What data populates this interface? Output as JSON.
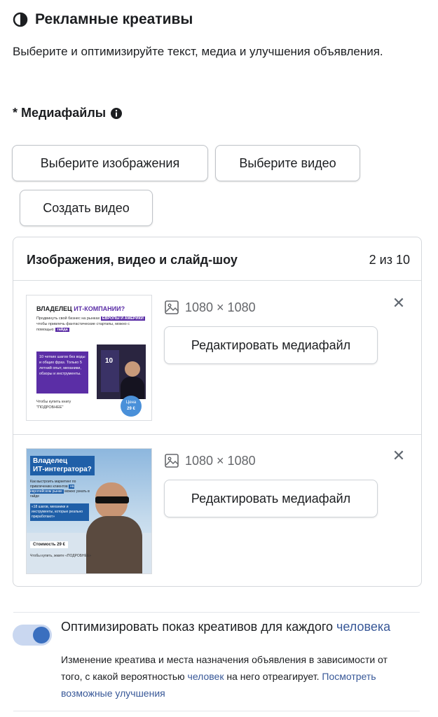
{
  "section": {
    "title": "Рекламные креативы",
    "description": "Выберите и оптимизируйте текст, медиа и улучшения объявления."
  },
  "media": {
    "label": "* Медиафайлы",
    "buttons": {
      "select_images": "Выберите изображения",
      "select_video": "Выберите видео",
      "create_video": "Создать видео"
    }
  },
  "library": {
    "title": "Изображения, видео и слайд-шоу",
    "count": "2 из 10",
    "items": [
      {
        "dimensions": "1080 × 1080",
        "edit_label": "Редактировать медиафайл",
        "thumb": {
          "heading_a": "ВЛАДЕЛЕЦ ",
          "heading_b": "ИТ-КОМПАНИИ?",
          "line1": "Продвинуть свой бизнес на рынках",
          "tag1": "ЕВРОПЫ И АМЕРИКИ",
          "line2": "чтобы привлечь",
          "line3": "фантастические стартапы, можно с помощью:",
          "tag2": "гайда",
          "box": "10 четких шагов без воды и общих фраз. Только 5 летний опыт, механики, обзоры и инструменты.",
          "foot": "Чтобы купить книгу \"ПОДРОБНЕЕ\"",
          "book_num": "10",
          "price_a": "Цена",
          "price_b": "29 €"
        }
      },
      {
        "dimensions": "1080 × 1080",
        "edit_label": "Редактировать медиафайл",
        "thumb": {
          "heading_a": "Владелец",
          "heading_b": "ИТ-интегратора?",
          "line1": "Как выстроить маркетинг по привлечению клиентов",
          "tag1": "на европейском рынке",
          "line2": "можно узнать в гайде",
          "box": "«18 шагов, механики и инструменты, которые реально приработают»",
          "price": "Стоимость 29 €",
          "foot": "Чтобы купить, жмите «ПОДРОБНЕЕ»"
        }
      }
    ]
  },
  "optimize": {
    "title_prefix": "Оптимизировать показ креативов для каждого ",
    "title_link": "человека",
    "desc_prefix": "Изменение креатива и места назначения объявления в зависимости от того, с какой вероятностью ",
    "desc_link1": "человек",
    "desc_middle": " на него отреагирует. ",
    "desc_link2": "Посмотреть возможные улучшения",
    "enabled": true
  },
  "colors": {
    "accent": "#385898",
    "toggle_knob": "#3a6fbf",
    "thumb_purple": "#5b2ea6",
    "thumb_blue": "#1f5fa8"
  }
}
